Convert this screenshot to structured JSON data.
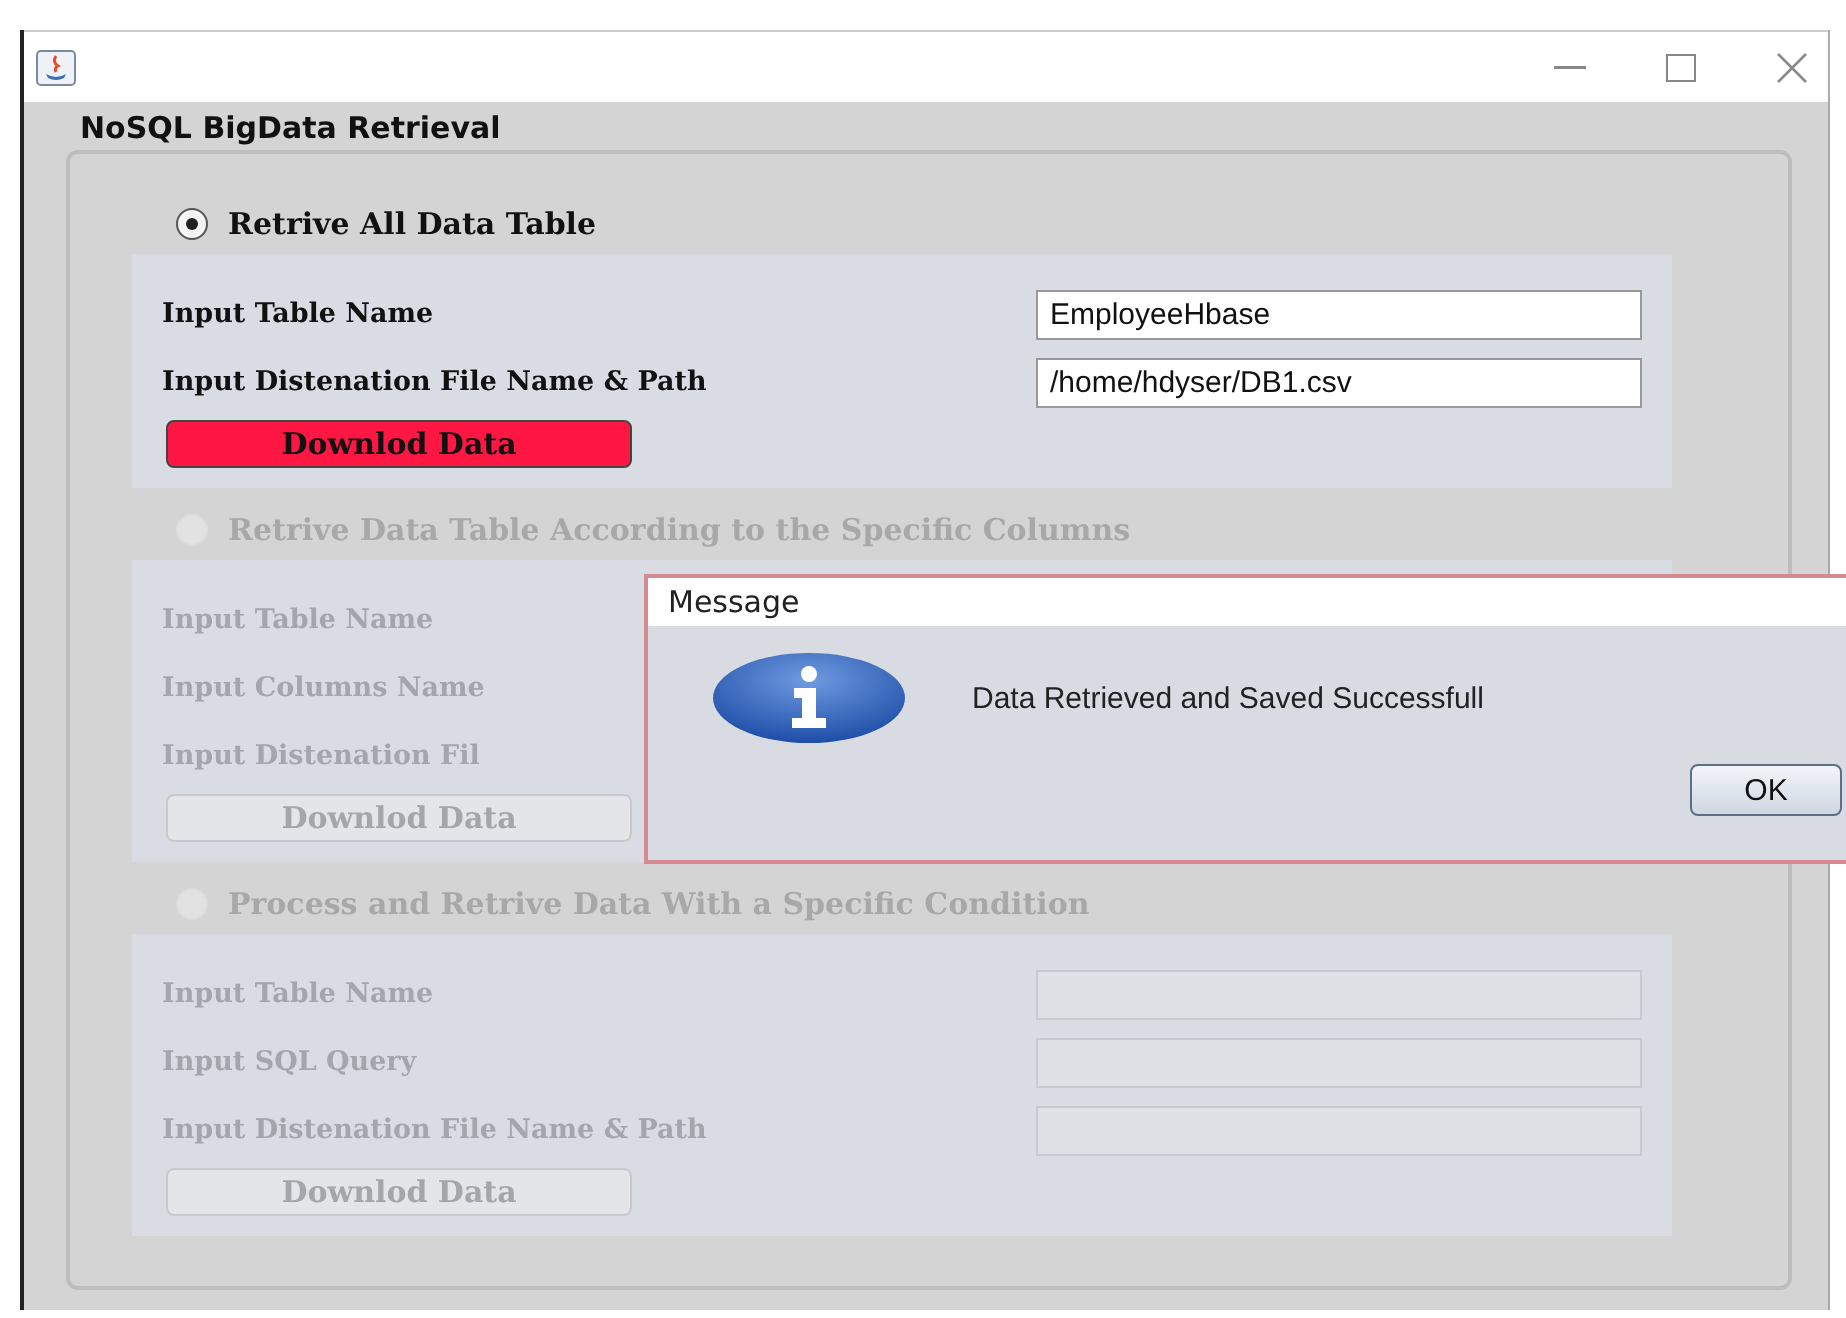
{
  "window": {
    "title": "NoSQL BigData Retrieval"
  },
  "sections": [
    {
      "label": "Retrive All Data Table",
      "selected": true,
      "enabled": true,
      "button": {
        "label": "Downlod Data",
        "focused": true
      },
      "fields": [
        {
          "kind": "text-field",
          "label": "Input Table Name",
          "value": "EmployeeHbase"
        },
        {
          "kind": "text-field",
          "label": "Input Distenation File Name & Path",
          "value": "/home/hdyser/DB1.csv"
        }
      ]
    },
    {
      "label": "Retrive Data Table According to the Specific Columns",
      "selected": false,
      "enabled": false,
      "button": {
        "label": "Downlod Data",
        "focused": false
      },
      "fields": [
        {
          "kind": "label",
          "label": "Input Table Name"
        },
        {
          "kind": "label",
          "label": "Input Columns Name"
        },
        {
          "kind": "label",
          "label": "Input Distenation Fil"
        }
      ]
    },
    {
      "label": "Process and Retrive Data With a Specific Condition",
      "selected": false,
      "enabled": false,
      "button": {
        "label": "Downlod Data",
        "focused": false
      },
      "fields": [
        {
          "kind": "text-field",
          "label": "Input Table Name"
        },
        {
          "kind": "text-field",
          "label": "Input SQL Query"
        },
        {
          "kind": "text-field",
          "label": "Input Distenation File Name & Path"
        }
      ]
    }
  ],
  "dialog": {
    "title": "Message",
    "message": "Data Retrieved and Saved Successfull",
    "button": "OK"
  }
}
